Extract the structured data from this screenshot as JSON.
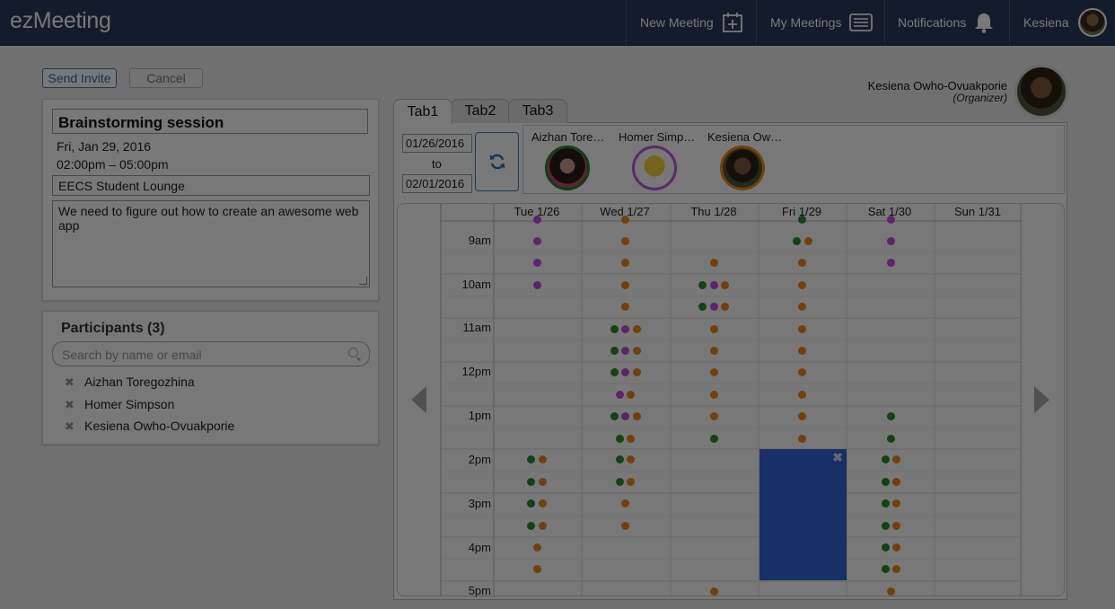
{
  "app": {
    "logo": "ezMeeting"
  },
  "nav": {
    "new_meeting": "New Meeting",
    "my_meetings": "My Meetings",
    "notifications": "Notifications",
    "user": "Kesiena"
  },
  "actions": {
    "send_invite": "Send Invite",
    "cancel": "Cancel"
  },
  "meeting": {
    "title": "Brainstorming session",
    "date": "Fri, Jan 29, 2016",
    "time": "02:00pm – 05:00pm",
    "location": "EECS Student Lounge",
    "description": "We need to figure out how to create an awesome web app"
  },
  "participants": {
    "heading": "Participants (3)",
    "search_placeholder": "Search by name or email",
    "remove_glyph": "✖",
    "list": [
      "Aizhan Toregozhina",
      "Homer Simpson",
      "Kesiena Owho-Ovuakporie"
    ]
  },
  "organizer": {
    "name": "Kesiena Owho-Ovuakporie",
    "role": "(Organizer)"
  },
  "tabs": [
    "Tab1",
    "Tab2",
    "Tab3"
  ],
  "range": {
    "from": "01/26/2016",
    "to_label": "to",
    "to": "02/01/2016"
  },
  "attendees": [
    {
      "name": "Aizhan Tore…",
      "ring_color": "#2e7d32"
    },
    {
      "name": "Homer Simp…",
      "ring_color": "#c25be0"
    },
    {
      "name": "Kesiena Ow…",
      "ring_color": "#ef8a1a"
    }
  ],
  "calendar": {
    "days": [
      "Tue 1/26",
      "Wed 1/27",
      "Thu 1/28",
      "Fri 1/29",
      "Sat 1/30",
      "Sun 1/31"
    ],
    "times": [
      "9am",
      "10am",
      "11am",
      "12pm",
      "1pm",
      "2pm",
      "3pm",
      "4pm",
      "5pm"
    ],
    "colors": {
      "aizhan": "#2e8b2e",
      "homer": "#c04fe0",
      "kesiena": "#ef8a1a"
    },
    "selection_close": "✖"
  }
}
